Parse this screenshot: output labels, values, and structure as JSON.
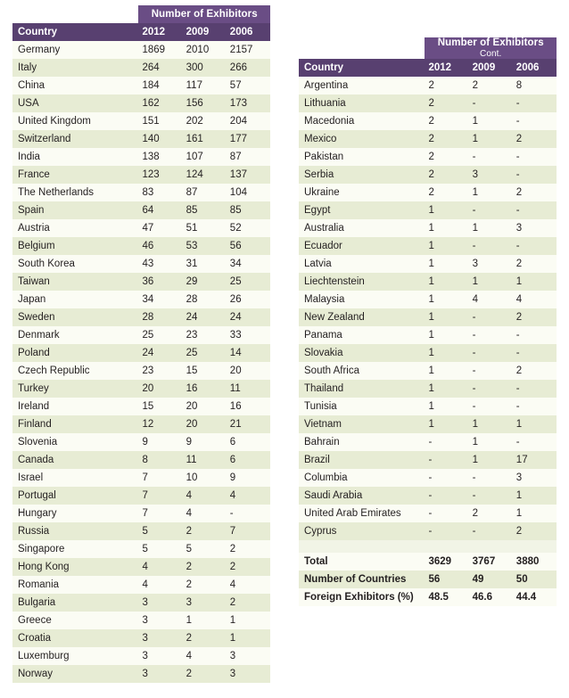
{
  "left_table": {
    "banner": "Number of Exhibitors",
    "banner_cont": "",
    "columns": [
      "Country",
      "2012",
      "2009",
      "2006"
    ],
    "rows": [
      {
        "country": "Germany",
        "y2012": "1869",
        "y2009": "2010",
        "y2006": "2157"
      },
      {
        "country": "Italy",
        "y2012": "264",
        "y2009": "300",
        "y2006": "266"
      },
      {
        "country": "China",
        "y2012": "184",
        "y2009": "117",
        "y2006": "57"
      },
      {
        "country": "USA",
        "y2012": "162",
        "y2009": "156",
        "y2006": "173"
      },
      {
        "country": "United Kingdom",
        "y2012": "151",
        "y2009": "202",
        "y2006": "204"
      },
      {
        "country": "Switzerland",
        "y2012": "140",
        "y2009": "161",
        "y2006": "177"
      },
      {
        "country": "India",
        "y2012": "138",
        "y2009": "107",
        "y2006": "87"
      },
      {
        "country": "France",
        "y2012": "123",
        "y2009": "124",
        "y2006": "137"
      },
      {
        "country": "The Netherlands",
        "y2012": "83",
        "y2009": "87",
        "y2006": "104"
      },
      {
        "country": "Spain",
        "y2012": "64",
        "y2009": "85",
        "y2006": "85"
      },
      {
        "country": "Austria",
        "y2012": "47",
        "y2009": "51",
        "y2006": "52"
      },
      {
        "country": "Belgium",
        "y2012": "46",
        "y2009": "53",
        "y2006": "56"
      },
      {
        "country": "South Korea",
        "y2012": "43",
        "y2009": "31",
        "y2006": "34"
      },
      {
        "country": "Taiwan",
        "y2012": "36",
        "y2009": "29",
        "y2006": "25"
      },
      {
        "country": "Japan",
        "y2012": "34",
        "y2009": "28",
        "y2006": "26"
      },
      {
        "country": "Sweden",
        "y2012": "28",
        "y2009": "24",
        "y2006": "24"
      },
      {
        "country": "Denmark",
        "y2012": "25",
        "y2009": "23",
        "y2006": "33"
      },
      {
        "country": "Poland",
        "y2012": "24",
        "y2009": "25",
        "y2006": "14"
      },
      {
        "country": "Czech Republic",
        "y2012": "23",
        "y2009": "15",
        "y2006": "20"
      },
      {
        "country": "Turkey",
        "y2012": "20",
        "y2009": "16",
        "y2006": "11"
      },
      {
        "country": "Ireland",
        "y2012": "15",
        "y2009": "20",
        "y2006": "16"
      },
      {
        "country": "Finland",
        "y2012": "12",
        "y2009": "20",
        "y2006": "21"
      },
      {
        "country": "Slovenia",
        "y2012": "9",
        "y2009": "9",
        "y2006": "6"
      },
      {
        "country": "Canada",
        "y2012": "8",
        "y2009": "11",
        "y2006": "6"
      },
      {
        "country": "Israel",
        "y2012": "7",
        "y2009": "10",
        "y2006": "9"
      },
      {
        "country": "Portugal",
        "y2012": "7",
        "y2009": "4",
        "y2006": "4"
      },
      {
        "country": "Hungary",
        "y2012": "7",
        "y2009": "4",
        "y2006": "-"
      },
      {
        "country": "Russia",
        "y2012": "5",
        "y2009": "2",
        "y2006": "7"
      },
      {
        "country": "Singapore",
        "y2012": "5",
        "y2009": "5",
        "y2006": "2"
      },
      {
        "country": "Hong Kong",
        "y2012": "4",
        "y2009": "2",
        "y2006": "2"
      },
      {
        "country": "Romania",
        "y2012": "4",
        "y2009": "2",
        "y2006": "4"
      },
      {
        "country": "Bulgaria",
        "y2012": "3",
        "y2009": "3",
        "y2006": "2"
      },
      {
        "country": "Greece",
        "y2012": "3",
        "y2009": "1",
        "y2006": "1"
      },
      {
        "country": "Croatia",
        "y2012": "3",
        "y2009": "2",
        "y2006": "1"
      },
      {
        "country": "Luxemburg",
        "y2012": "3",
        "y2009": "4",
        "y2006": "3"
      },
      {
        "country": "Norway",
        "y2012": "3",
        "y2009": "2",
        "y2006": "3"
      }
    ]
  },
  "right_table": {
    "banner": "Number of Exhibitors",
    "banner_cont": "Cont.",
    "columns": [
      "Country",
      "2012",
      "2009",
      "2006"
    ],
    "rows": [
      {
        "country": "Argentina",
        "y2012": "2",
        "y2009": "2",
        "y2006": "8"
      },
      {
        "country": "Lithuania",
        "y2012": "2",
        "y2009": "-",
        "y2006": "-"
      },
      {
        "country": "Macedonia",
        "y2012": "2",
        "y2009": "1",
        "y2006": "-"
      },
      {
        "country": "Mexico",
        "y2012": "2",
        "y2009": "1",
        "y2006": "2"
      },
      {
        "country": "Pakistan",
        "y2012": "2",
        "y2009": "-",
        "y2006": "-"
      },
      {
        "country": "Serbia",
        "y2012": "2",
        "y2009": "3",
        "y2006": "-"
      },
      {
        "country": "Ukraine",
        "y2012": "2",
        "y2009": "1",
        "y2006": "2"
      },
      {
        "country": "Egypt",
        "y2012": "1",
        "y2009": "-",
        "y2006": "-"
      },
      {
        "country": "Australia",
        "y2012": "1",
        "y2009": "1",
        "y2006": "3"
      },
      {
        "country": "Ecuador",
        "y2012": "1",
        "y2009": "-",
        "y2006": "-"
      },
      {
        "country": "Latvia",
        "y2012": "1",
        "y2009": "3",
        "y2006": "2"
      },
      {
        "country": "Liechtenstein",
        "y2012": "1",
        "y2009": "1",
        "y2006": "1"
      },
      {
        "country": "Malaysia",
        "y2012": "1",
        "y2009": "4",
        "y2006": "4"
      },
      {
        "country": "New Zealand",
        "y2012": "1",
        "y2009": "-",
        "y2006": "2"
      },
      {
        "country": "Panama",
        "y2012": "1",
        "y2009": "-",
        "y2006": "-"
      },
      {
        "country": "Slovakia",
        "y2012": "1",
        "y2009": "-",
        "y2006": "-"
      },
      {
        "country": "South Africa",
        "y2012": "1",
        "y2009": "-",
        "y2006": "2"
      },
      {
        "country": "Thailand",
        "y2012": "1",
        "y2009": "-",
        "y2006": "-"
      },
      {
        "country": "Tunisia",
        "y2012": "1",
        "y2009": "-",
        "y2006": "-"
      },
      {
        "country": "Vietnam",
        "y2012": "1",
        "y2009": "1",
        "y2006": "1"
      },
      {
        "country": "Bahrain",
        "y2012": "-",
        "y2009": "1",
        "y2006": "-"
      },
      {
        "country": "Brazil",
        "y2012": "-",
        "y2009": "1",
        "y2006": "17"
      },
      {
        "country": "Columbia",
        "y2012": "-",
        "y2009": "-",
        "y2006": "3"
      },
      {
        "country": "Saudi Arabia",
        "y2012": "-",
        "y2009": "-",
        "y2006": "1"
      },
      {
        "country": "United Arab Emirates",
        "y2012": "-",
        "y2009": "2",
        "y2006": "1"
      },
      {
        "country": "Cyprus",
        "y2012": "-",
        "y2009": "-",
        "y2006": "2"
      }
    ],
    "summary": [
      {
        "label": "Total",
        "y2012": "3629",
        "y2009": "3767",
        "y2006": "3880"
      },
      {
        "label": "Number of Countries",
        "y2012": "56",
        "y2009": "49",
        "y2006": "50"
      },
      {
        "label": "Foreign Exhibitors (%)",
        "y2012": "48.5",
        "y2009": "46.6",
        "y2006": "44.4"
      }
    ]
  },
  "colors": {
    "banner_purple": "#6a4d85",
    "header_purple": "#584070",
    "row_light": "#fbfcf4",
    "row_green": "#e7ecd4",
    "text": "#231f20"
  },
  "chart_data": {
    "type": "table",
    "title": "Number of Exhibitors",
    "categories": [
      "2012",
      "2009",
      "2006"
    ],
    "series": [
      {
        "name": "Germany",
        "values": [
          1869,
          2010,
          2157
        ]
      },
      {
        "name": "Italy",
        "values": [
          264,
          300,
          266
        ]
      },
      {
        "name": "China",
        "values": [
          184,
          117,
          57
        ]
      },
      {
        "name": "USA",
        "values": [
          162,
          156,
          173
        ]
      },
      {
        "name": "United Kingdom",
        "values": [
          151,
          202,
          204
        ]
      },
      {
        "name": "Switzerland",
        "values": [
          140,
          161,
          177
        ]
      },
      {
        "name": "India",
        "values": [
          138,
          107,
          87
        ]
      },
      {
        "name": "France",
        "values": [
          123,
          124,
          137
        ]
      },
      {
        "name": "The Netherlands",
        "values": [
          83,
          87,
          104
        ]
      },
      {
        "name": "Spain",
        "values": [
          64,
          85,
          85
        ]
      },
      {
        "name": "Austria",
        "values": [
          47,
          51,
          52
        ]
      },
      {
        "name": "Belgium",
        "values": [
          46,
          53,
          56
        ]
      },
      {
        "name": "South Korea",
        "values": [
          43,
          31,
          34
        ]
      },
      {
        "name": "Taiwan",
        "values": [
          36,
          29,
          25
        ]
      },
      {
        "name": "Japan",
        "values": [
          34,
          28,
          26
        ]
      },
      {
        "name": "Sweden",
        "values": [
          28,
          24,
          24
        ]
      },
      {
        "name": "Denmark",
        "values": [
          25,
          23,
          33
        ]
      },
      {
        "name": "Poland",
        "values": [
          24,
          25,
          14
        ]
      },
      {
        "name": "Czech Republic",
        "values": [
          23,
          15,
          20
        ]
      },
      {
        "name": "Turkey",
        "values": [
          20,
          16,
          11
        ]
      },
      {
        "name": "Ireland",
        "values": [
          15,
          20,
          16
        ]
      },
      {
        "name": "Finland",
        "values": [
          12,
          20,
          21
        ]
      },
      {
        "name": "Slovenia",
        "values": [
          9,
          9,
          6
        ]
      },
      {
        "name": "Canada",
        "values": [
          8,
          11,
          6
        ]
      },
      {
        "name": "Israel",
        "values": [
          7,
          10,
          9
        ]
      },
      {
        "name": "Portugal",
        "values": [
          7,
          4,
          4
        ]
      },
      {
        "name": "Hungary",
        "values": [
          7,
          4,
          null
        ]
      },
      {
        "name": "Russia",
        "values": [
          5,
          2,
          7
        ]
      },
      {
        "name": "Singapore",
        "values": [
          5,
          5,
          2
        ]
      },
      {
        "name": "Hong Kong",
        "values": [
          4,
          2,
          2
        ]
      },
      {
        "name": "Romania",
        "values": [
          4,
          2,
          4
        ]
      },
      {
        "name": "Bulgaria",
        "values": [
          3,
          3,
          2
        ]
      },
      {
        "name": "Greece",
        "values": [
          3,
          1,
          1
        ]
      },
      {
        "name": "Croatia",
        "values": [
          3,
          2,
          1
        ]
      },
      {
        "name": "Luxemburg",
        "values": [
          3,
          4,
          3
        ]
      },
      {
        "name": "Norway",
        "values": [
          3,
          2,
          3
        ]
      },
      {
        "name": "Argentina",
        "values": [
          2,
          2,
          8
        ]
      },
      {
        "name": "Lithuania",
        "values": [
          2,
          null,
          null
        ]
      },
      {
        "name": "Macedonia",
        "values": [
          2,
          1,
          null
        ]
      },
      {
        "name": "Mexico",
        "values": [
          2,
          1,
          2
        ]
      },
      {
        "name": "Pakistan",
        "values": [
          2,
          null,
          null
        ]
      },
      {
        "name": "Serbia",
        "values": [
          2,
          3,
          null
        ]
      },
      {
        "name": "Ukraine",
        "values": [
          2,
          1,
          2
        ]
      },
      {
        "name": "Egypt",
        "values": [
          1,
          null,
          null
        ]
      },
      {
        "name": "Australia",
        "values": [
          1,
          1,
          3
        ]
      },
      {
        "name": "Ecuador",
        "values": [
          1,
          null,
          null
        ]
      },
      {
        "name": "Latvia",
        "values": [
          1,
          3,
          2
        ]
      },
      {
        "name": "Liechtenstein",
        "values": [
          1,
          1,
          1
        ]
      },
      {
        "name": "Malaysia",
        "values": [
          1,
          4,
          4
        ]
      },
      {
        "name": "New Zealand",
        "values": [
          1,
          null,
          2
        ]
      },
      {
        "name": "Panama",
        "values": [
          1,
          null,
          null
        ]
      },
      {
        "name": "Slovakia",
        "values": [
          1,
          null,
          null
        ]
      },
      {
        "name": "South Africa",
        "values": [
          1,
          null,
          2
        ]
      },
      {
        "name": "Thailand",
        "values": [
          1,
          null,
          null
        ]
      },
      {
        "name": "Tunisia",
        "values": [
          1,
          null,
          null
        ]
      },
      {
        "name": "Vietnam",
        "values": [
          1,
          1,
          1
        ]
      },
      {
        "name": "Bahrain",
        "values": [
          null,
          1,
          null
        ]
      },
      {
        "name": "Brazil",
        "values": [
          null,
          1,
          17
        ]
      },
      {
        "name": "Columbia",
        "values": [
          null,
          null,
          3
        ]
      },
      {
        "name": "Saudi Arabia",
        "values": [
          null,
          null,
          1
        ]
      },
      {
        "name": "United Arab Emirates",
        "values": [
          null,
          2,
          1
        ]
      },
      {
        "name": "Cyprus",
        "values": [
          null,
          null,
          2
        ]
      }
    ],
    "totals": {
      "Total": [
        3629,
        3767,
        3880
      ],
      "Number of Countries": [
        56,
        49,
        50
      ],
      "Foreign Exhibitors (%)": [
        48.5,
        46.6,
        44.4
      ]
    },
    "xlabel": "",
    "ylabel": ""
  }
}
